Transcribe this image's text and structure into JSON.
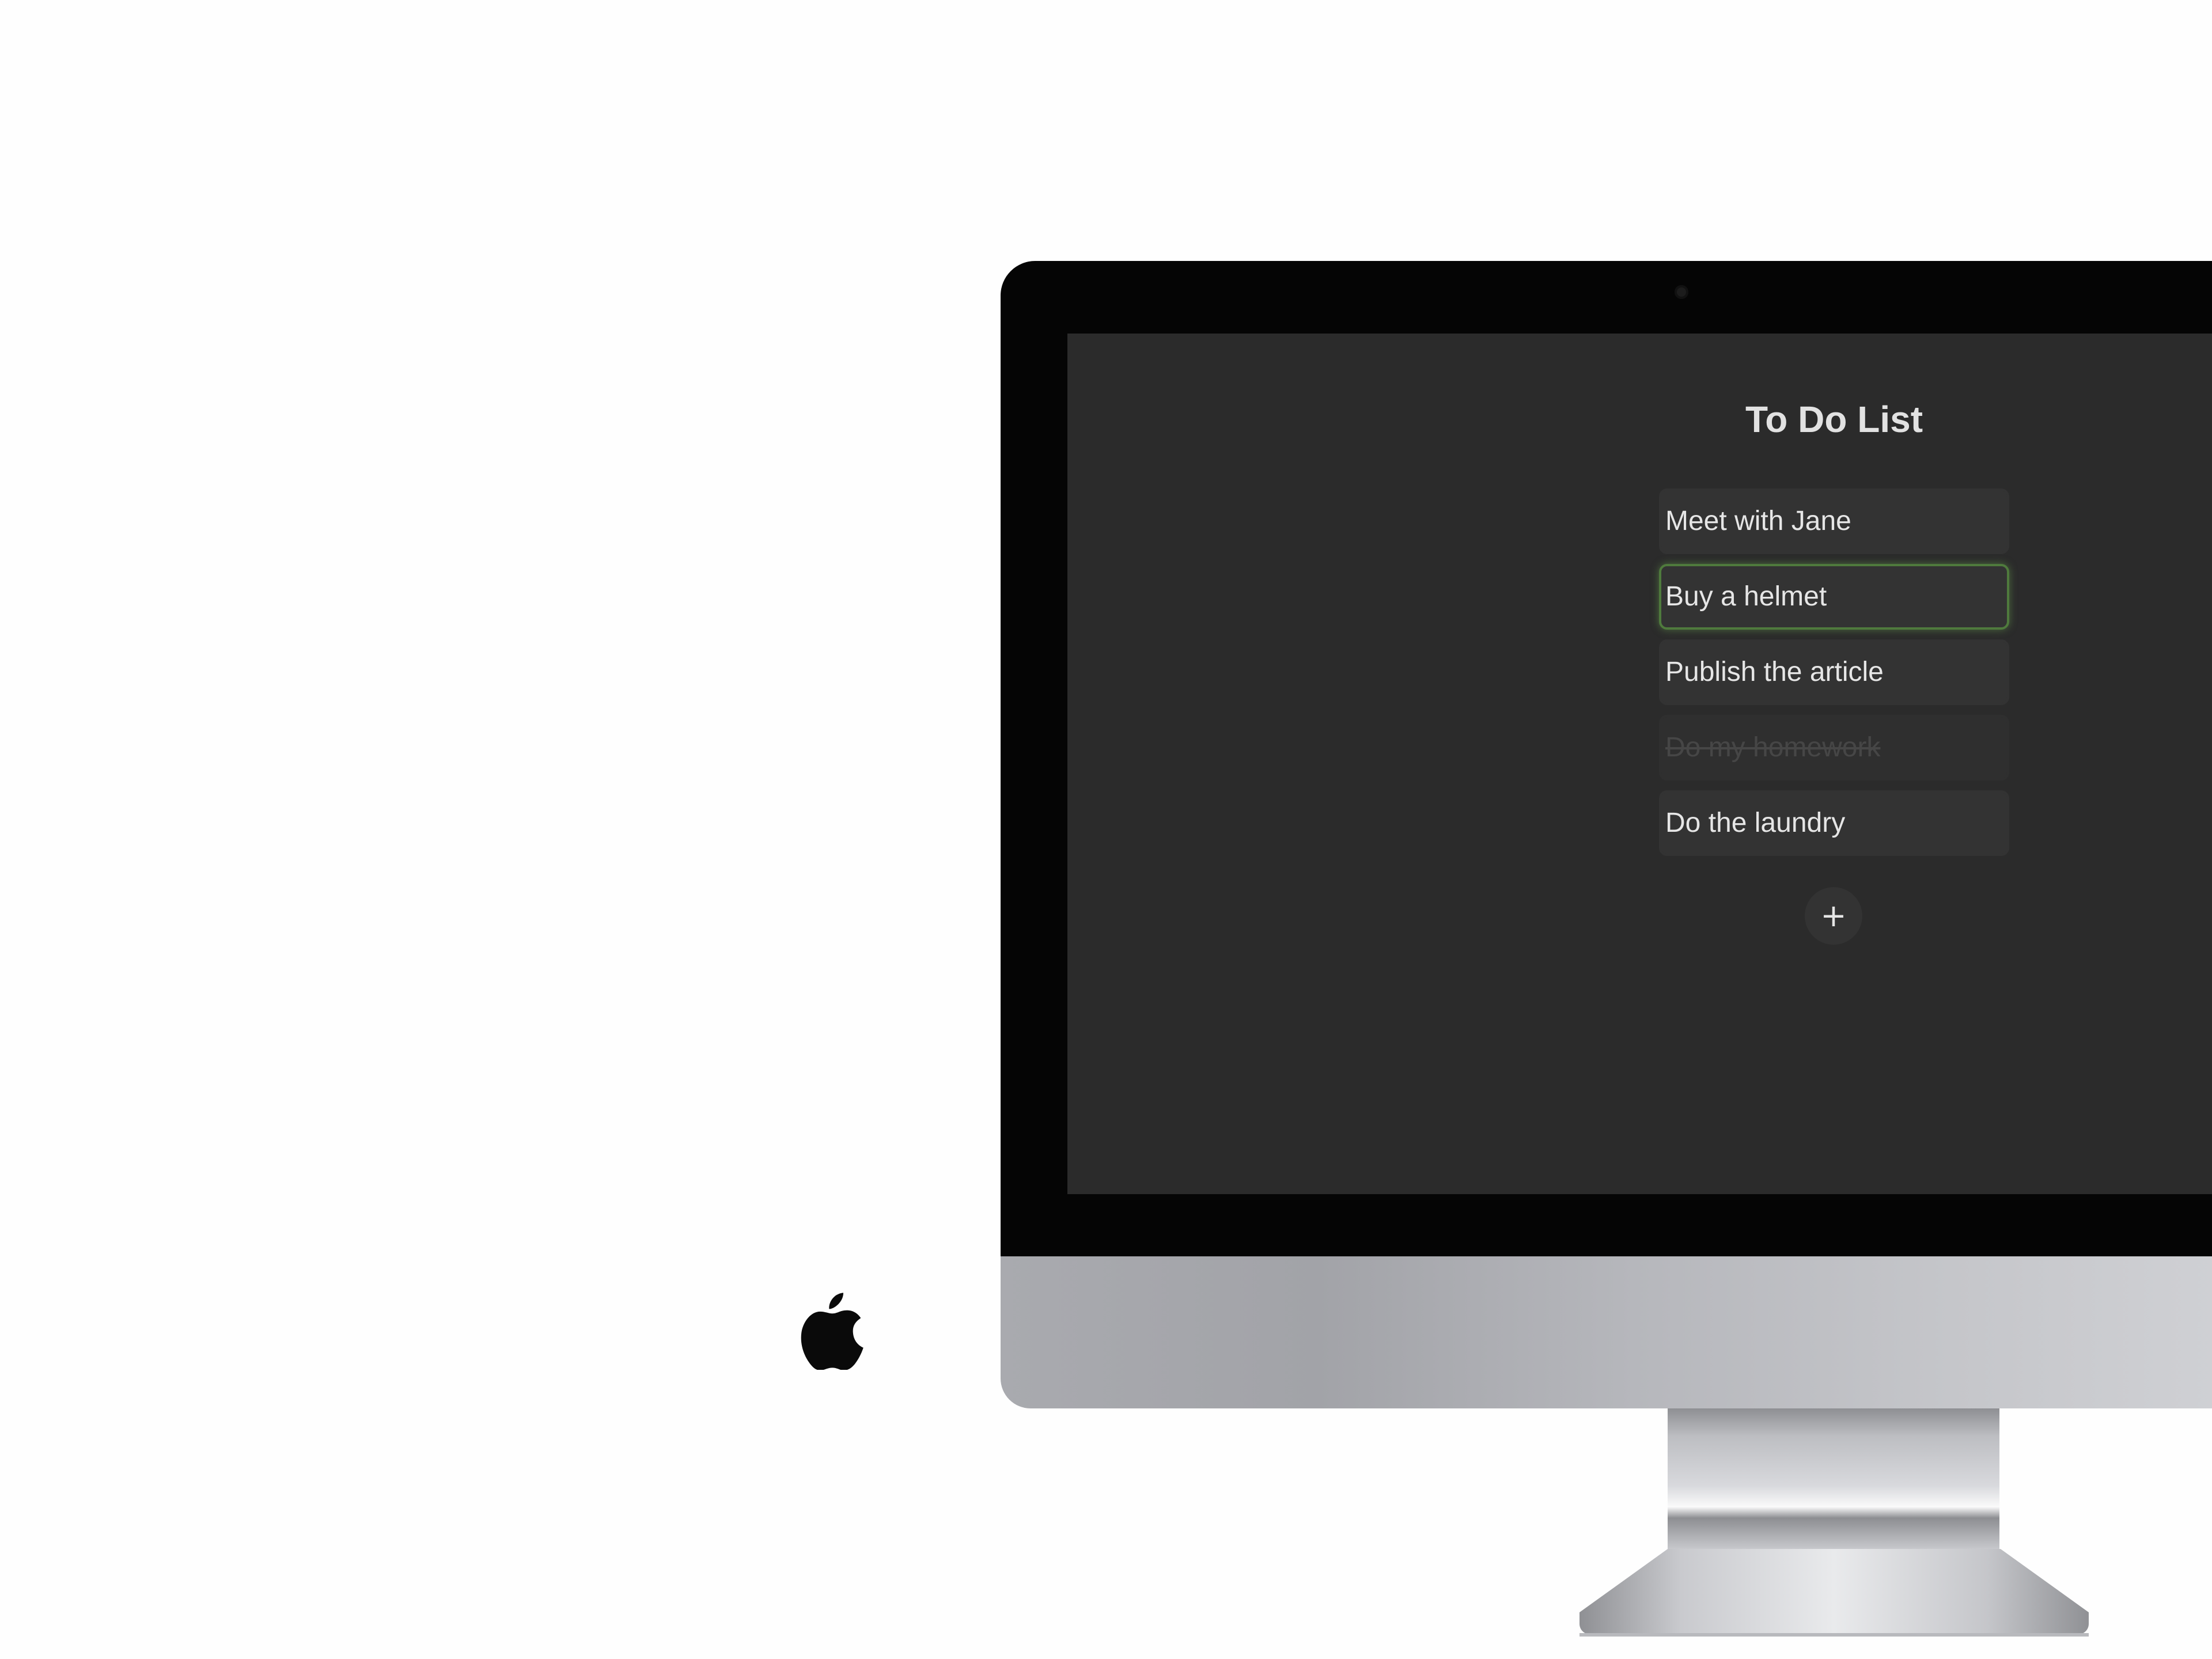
{
  "app": {
    "title": "To Do List",
    "tasks": [
      {
        "label": "Meet with Jane",
        "completed": false,
        "focused": false
      },
      {
        "label": "Buy a helmet",
        "completed": false,
        "focused": true
      },
      {
        "label": "Publish the article",
        "completed": false,
        "focused": false
      },
      {
        "label": "Do my homework",
        "completed": true,
        "focused": false
      },
      {
        "label": "Do the laundry",
        "completed": false,
        "focused": false
      }
    ],
    "add_button": {
      "icon": "plus-icon",
      "glyph": "+"
    }
  },
  "colors": {
    "screen_background": "#2b2b2b",
    "task_background": "#333333",
    "task_text": "#e6e6e6",
    "completed_text": "#464646",
    "focus_accent": "#4f7a3d",
    "page_background": "#fefefe"
  },
  "device": {
    "type": "imac",
    "logo_icon": "apple-logo-icon"
  }
}
